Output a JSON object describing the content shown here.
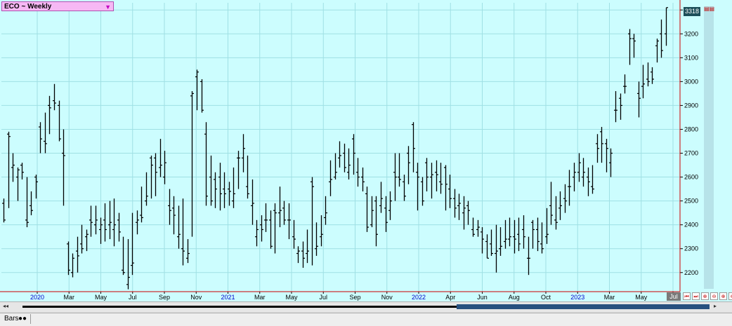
{
  "symbol": {
    "label": "ECO ~ Weekly",
    "dropdown": "▼"
  },
  "last_price": "3318",
  "top_marks": "▤▤",
  "nav_buttons": [
    "⏮",
    "⏭",
    "⊕",
    "⊖",
    "⊕",
    "⊖"
  ],
  "scroll": {
    "left": "◂◂",
    "right": "▸"
  },
  "bottom": {
    "bars_label": "Bars",
    "bars_dots": "●●"
  },
  "current_month_tab": "Jul",
  "colors": {
    "background": "#ccfdfe",
    "grid": "#9fe0e4",
    "bars": "#000000",
    "axis": "#cc0000",
    "year_labels": "#0000cc"
  },
  "chart_data": {
    "type": "bar",
    "chart_style": "OHLC",
    "title": "ECO ~ Weekly",
    "y_axis": {
      "ticks": [
        2200,
        2300,
        2400,
        2500,
        2600,
        2700,
        2800,
        2900,
        3000,
        3100,
        3200,
        3300
      ],
      "range": [
        2120,
        3330
      ],
      "side": "right"
    },
    "x_axis": {
      "labels": [
        {
          "text": "2020",
          "year": true
        },
        {
          "text": "Mar",
          "year": false
        },
        {
          "text": "May",
          "year": false
        },
        {
          "text": "Jul",
          "year": false
        },
        {
          "text": "Sep",
          "year": false
        },
        {
          "text": "Nov",
          "year": false
        },
        {
          "text": "2021",
          "year": true
        },
        {
          "text": "Mar",
          "year": false
        },
        {
          "text": "May",
          "year": false
        },
        {
          "text": "Jul",
          "year": false
        },
        {
          "text": "Sep",
          "year": false
        },
        {
          "text": "Nov",
          "year": false
        },
        {
          "text": "2022",
          "year": true
        },
        {
          "text": "Apr",
          "year": false
        },
        {
          "text": "Jun",
          "year": false
        },
        {
          "text": "Aug",
          "year": false
        },
        {
          "text": "Oct",
          "year": false
        },
        {
          "text": "2023",
          "year": true
        },
        {
          "text": "Mar",
          "year": false
        },
        {
          "text": "May",
          "year": false
        },
        {
          "text": "Jul",
          "year": false
        }
      ]
    },
    "grid": true,
    "legend": "none",
    "bars": [
      [
        2490,
        2510,
        2410,
        2420
      ],
      [
        2780,
        2790,
        2470,
        2770
      ],
      [
        2640,
        2700,
        2580,
        2650
      ],
      [
        2600,
        2640,
        2500,
        2630
      ],
      [
        2650,
        2660,
        2590,
        2620
      ],
      [
        2420,
        2600,
        2390,
        2410
      ],
      [
        2480,
        2540,
        2440,
        2460
      ],
      [
        2600,
        2610,
        2510,
        2580
      ],
      [
        2810,
        2830,
        2700,
        2760
      ],
      [
        2750,
        2870,
        2700,
        2740
      ],
      [
        2900,
        2940,
        2780,
        2890
      ],
      [
        2920,
        2990,
        2880,
        2910
      ],
      [
        2900,
        2920,
        2750,
        2760
      ],
      [
        2700,
        2800,
        2480,
        2690
      ],
      [
        2320,
        2330,
        2190,
        2210
      ],
      [
        2200,
        2280,
        2180,
        2260
      ],
      [
        2290,
        2350,
        2200,
        2270
      ],
      [
        2320,
        2400,
        2280,
        2300
      ],
      [
        2350,
        2380,
        2290,
        2360
      ],
      [
        2420,
        2480,
        2350,
        2410
      ],
      [
        2400,
        2480,
        2360,
        2420
      ],
      [
        2380,
        2430,
        2320,
        2400
      ],
      [
        2420,
        2490,
        2330,
        2380
      ],
      [
        2400,
        2500,
        2340,
        2410
      ],
      [
        2380,
        2510,
        2310,
        2400
      ],
      [
        2420,
        2450,
        2330,
        2370
      ],
      [
        2210,
        2350,
        2190,
        2200
      ],
      [
        2150,
        2340,
        2130,
        2180
      ],
      [
        2230,
        2450,
        2190,
        2240
      ],
      [
        2410,
        2460,
        2360,
        2420
      ],
      [
        2440,
        2560,
        2410,
        2430
      ],
      [
        2500,
        2620,
        2480,
        2520
      ],
      [
        2680,
        2690,
        2510,
        2650
      ],
      [
        2680,
        2700,
        2520,
        2620
      ],
      [
        2640,
        2760,
        2600,
        2650
      ],
      [
        2600,
        2710,
        2570,
        2660
      ],
      [
        2480,
        2550,
        2400,
        2460
      ],
      [
        2470,
        2520,
        2360,
        2440
      ],
      [
        2350,
        2480,
        2300,
        2360
      ],
      [
        2300,
        2510,
        2230,
        2290
      ],
      [
        2260,
        2340,
        2240,
        2280
      ],
      [
        2940,
        2960,
        2350,
        2950
      ],
      [
        3020,
        3050,
        2880,
        3040
      ],
      [
        3000,
        3010,
        2870,
        2880
      ],
      [
        2780,
        2830,
        2480,
        2520
      ],
      [
        2600,
        2690,
        2480,
        2500
      ],
      [
        2590,
        2620,
        2470,
        2550
      ],
      [
        2600,
        2660,
        2460,
        2530
      ],
      [
        2550,
        2620,
        2470,
        2530
      ],
      [
        2550,
        2580,
        2480,
        2540
      ],
      [
        2500,
        2640,
        2470,
        2530
      ],
      [
        2680,
        2710,
        2550,
        2680
      ],
      [
        2680,
        2780,
        2620,
        2720
      ],
      [
        2560,
        2690,
        2510,
        2530
      ],
      [
        2480,
        2590,
        2400,
        2490
      ],
      [
        2350,
        2420,
        2310,
        2380
      ],
      [
        2400,
        2440,
        2330,
        2380
      ],
      [
        2420,
        2490,
        2370,
        2420
      ],
      [
        2420,
        2460,
        2300,
        2310
      ],
      [
        2460,
        2490,
        2280,
        2450
      ],
      [
        2450,
        2560,
        2390,
        2460
      ],
      [
        2470,
        2500,
        2400,
        2420
      ],
      [
        2420,
        2490,
        2340,
        2420
      ],
      [
        2350,
        2420,
        2300,
        2340
      ],
      [
        2280,
        2310,
        2240,
        2290
      ],
      [
        2290,
        2330,
        2220,
        2260
      ],
      [
        2280,
        2380,
        2240,
        2290
      ],
      [
        2580,
        2600,
        2230,
        2560
      ],
      [
        2300,
        2410,
        2270,
        2310
      ],
      [
        2350,
        2440,
        2310,
        2360
      ],
      [
        2430,
        2520,
        2400,
        2450
      ],
      [
        2580,
        2670,
        2520,
        2590
      ],
      [
        2600,
        2700,
        2590,
        2620
      ],
      [
        2680,
        2750,
        2640,
        2690
      ],
      [
        2700,
        2740,
        2620,
        2640
      ],
      [
        2620,
        2720,
        2590,
        2650
      ],
      [
        2760,
        2780,
        2610,
        2700
      ],
      [
        2620,
        2680,
        2560,
        2600
      ],
      [
        2600,
        2640,
        2540,
        2580
      ],
      [
        2530,
        2560,
        2370,
        2390
      ],
      [
        2400,
        2520,
        2390,
        2460
      ],
      [
        2500,
        2520,
        2310,
        2360
      ],
      [
        2480,
        2580,
        2450,
        2510
      ],
      [
        2470,
        2520,
        2370,
        2410
      ],
      [
        2460,
        2540,
        2420,
        2500
      ],
      [
        2620,
        2700,
        2500,
        2600
      ],
      [
        2600,
        2700,
        2560,
        2590
      ],
      [
        2580,
        2610,
        2500,
        2520
      ],
      [
        2700,
        2730,
        2570,
        2660
      ],
      [
        2820,
        2830,
        2620,
        2720
      ],
      [
        2620,
        2660,
        2460,
        2600
      ],
      [
        2580,
        2600,
        2480,
        2500
      ],
      [
        2660,
        2680,
        2540,
        2600
      ],
      [
        2600,
        2660,
        2510,
        2610
      ],
      [
        2620,
        2670,
        2540,
        2610
      ],
      [
        2580,
        2660,
        2530,
        2570
      ],
      [
        2640,
        2650,
        2460,
        2570
      ],
      [
        2550,
        2610,
        2470,
        2510
      ],
      [
        2510,
        2550,
        2430,
        2470
      ],
      [
        2480,
        2530,
        2420,
        2490
      ],
      [
        2450,
        2520,
        2380,
        2470
      ],
      [
        2480,
        2500,
        2400,
        2460
      ],
      [
        2380,
        2430,
        2350,
        2360
      ],
      [
        2380,
        2420,
        2350,
        2390
      ],
      [
        2370,
        2390,
        2280,
        2340
      ],
      [
        2330,
        2360,
        2260,
        2260
      ],
      [
        2320,
        2380,
        2270,
        2280
      ],
      [
        2280,
        2400,
        2200,
        2290
      ],
      [
        2300,
        2390,
        2270,
        2310
      ],
      [
        2330,
        2420,
        2300,
        2340
      ],
      [
        2340,
        2430,
        2310,
        2350
      ],
      [
        2350,
        2420,
        2280,
        2340
      ],
      [
        2360,
        2430,
        2290,
        2320
      ],
      [
        2380,
        2440,
        2300,
        2350
      ],
      [
        2260,
        2350,
        2190,
        2260
      ],
      [
        2410,
        2420,
        2300,
        2380
      ],
      [
        2380,
        2430,
        2290,
        2330
      ],
      [
        2320,
        2410,
        2280,
        2300
      ],
      [
        2350,
        2470,
        2320,
        2360
      ],
      [
        2480,
        2580,
        2400,
        2440
      ],
      [
        2420,
        2520,
        2380,
        2410
      ],
      [
        2470,
        2540,
        2420,
        2480
      ],
      [
        2510,
        2570,
        2450,
        2500
      ],
      [
        2560,
        2630,
        2480,
        2560
      ],
      [
        2600,
        2660,
        2540,
        2620
      ],
      [
        2620,
        2700,
        2580,
        2660
      ],
      [
        2600,
        2680,
        2560,
        2620
      ],
      [
        2600,
        2640,
        2520,
        2580
      ],
      [
        2560,
        2650,
        2530,
        2550
      ],
      [
        2740,
        2780,
        2660,
        2720
      ],
      [
        2790,
        2810,
        2660,
        2740
      ],
      [
        2740,
        2760,
        2620,
        2720
      ],
      [
        2660,
        2720,
        2600,
        2700
      ],
      [
        2880,
        2960,
        2830,
        2880
      ],
      [
        2930,
        2950,
        2840,
        2900
      ],
      [
        2980,
        3030,
        2950,
        2980
      ],
      [
        3200,
        3220,
        3070,
        3180
      ],
      [
        3180,
        3200,
        3100,
        3170
      ],
      [
        2950,
        3000,
        2850,
        2930
      ],
      [
        2980,
        3070,
        2930,
        2990
      ],
      [
        3010,
        3080,
        2980,
        3000
      ],
      [
        3040,
        3060,
        2990,
        3010
      ],
      [
        3150,
        3180,
        3080,
        3170
      ],
      [
        3200,
        3260,
        3100,
        3130
      ],
      [
        3200,
        3310,
        3150,
        3310
      ]
    ]
  }
}
